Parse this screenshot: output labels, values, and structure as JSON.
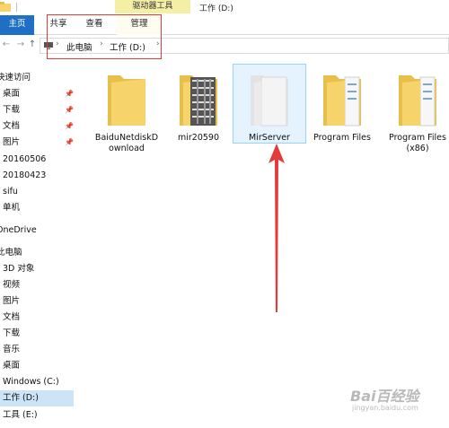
{
  "window": {
    "context_group": "驱动器工具",
    "title": "工作 (D:)"
  },
  "ribbon": {
    "tabs": [
      {
        "label": "主页"
      },
      {
        "label": "共享"
      },
      {
        "label": "查看"
      },
      {
        "label": "管理"
      }
    ]
  },
  "address": {
    "crumbs": [
      "此电脑",
      "工作 (D:)"
    ],
    "separator": "›"
  },
  "nav": {
    "items": [
      {
        "label": "快速访问",
        "pinned": false
      },
      {
        "label": "桌面",
        "pinned": true
      },
      {
        "label": "下载",
        "pinned": true
      },
      {
        "label": "文档",
        "pinned": true
      },
      {
        "label": "图片",
        "pinned": true
      },
      {
        "label": "20160506",
        "pinned": false
      },
      {
        "label": "20180423",
        "pinned": false
      },
      {
        "label": "sifu",
        "pinned": false
      },
      {
        "label": "单机",
        "pinned": false
      },
      {
        "label": "OneDrive",
        "pinned": false
      },
      {
        "label": "此电脑",
        "pinned": false
      },
      {
        "label": "3D 对象",
        "pinned": false
      },
      {
        "label": "视频",
        "pinned": false
      },
      {
        "label": "图片",
        "pinned": false
      },
      {
        "label": "文档",
        "pinned": false
      },
      {
        "label": "下载",
        "pinned": false
      },
      {
        "label": "音乐",
        "pinned": false
      },
      {
        "label": "桌面",
        "pinned": false
      },
      {
        "label": "Windows (C:)",
        "pinned": false
      },
      {
        "label": "工作 (D:)",
        "pinned": false,
        "selected": true
      },
      {
        "label": "工具 (E:)",
        "pinned": false
      }
    ],
    "pin_glyph": "📌"
  },
  "files": [
    {
      "label_line1": "BaiduNetdiskD",
      "label_line2": "ownload",
      "icon": "folder-icon"
    },
    {
      "label_line1": "mir20590",
      "label_line2": "",
      "icon": "folder-image-icon"
    },
    {
      "label_line1": "MirServer",
      "label_line2": "",
      "icon": "folder-icon",
      "selected": true
    },
    {
      "label_line1": "Program Files",
      "label_line2": "",
      "icon": "folder-icon"
    },
    {
      "label_line1": "Program Files",
      "label_line2": "(x86)",
      "icon": "folder-icon"
    }
  ],
  "watermark": {
    "text": "Bai百经验",
    "sub": "jingyan.baidu.com"
  },
  "colors": {
    "accent": "#1f6fc5",
    "folder": "#f6d36b",
    "annotation": "#e33a3a",
    "selection": "#cce4f7"
  }
}
